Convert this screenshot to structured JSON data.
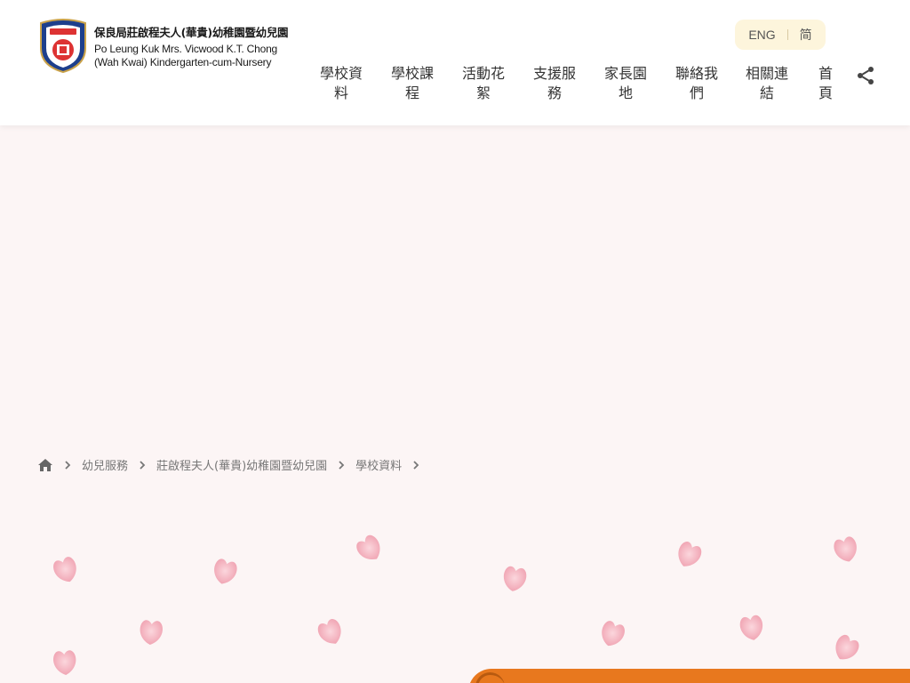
{
  "header": {
    "logo_zh": "保良局莊啟程夫人(華貴)幼稚園暨幼兒園",
    "logo_en_line1": "Po Leung Kuk Mrs. Vicwood K.T. Chong",
    "logo_en_line2": "(Wah Kwai) Kindergarten-cum-Nursery",
    "lang": {
      "eng": "ENG",
      "simplified": "简"
    },
    "nav": [
      {
        "label": "學校資\n料"
      },
      {
        "label": "學校課\n程"
      },
      {
        "label": "活動花\n絮"
      },
      {
        "label": "支援服\n務"
      },
      {
        "label": "家長園\n地"
      },
      {
        "label": "聯絡我\n們"
      },
      {
        "label": "相關連\n結"
      },
      {
        "label": "首\n頁"
      }
    ],
    "share_icon": "share-icon"
  },
  "breadcrumb": {
    "home_icon": "home-icon",
    "items": [
      "幼兒服務",
      "莊啟程夫人(華貴)幼稚園暨幼兒園",
      "學校資料"
    ]
  },
  "colors": {
    "background": "#fcf5f5",
    "header_bg": "#ffffff",
    "lang_bg": "#fdf5dc",
    "accent_orange": "#e8781e",
    "petal": "#f2a7b4"
  }
}
